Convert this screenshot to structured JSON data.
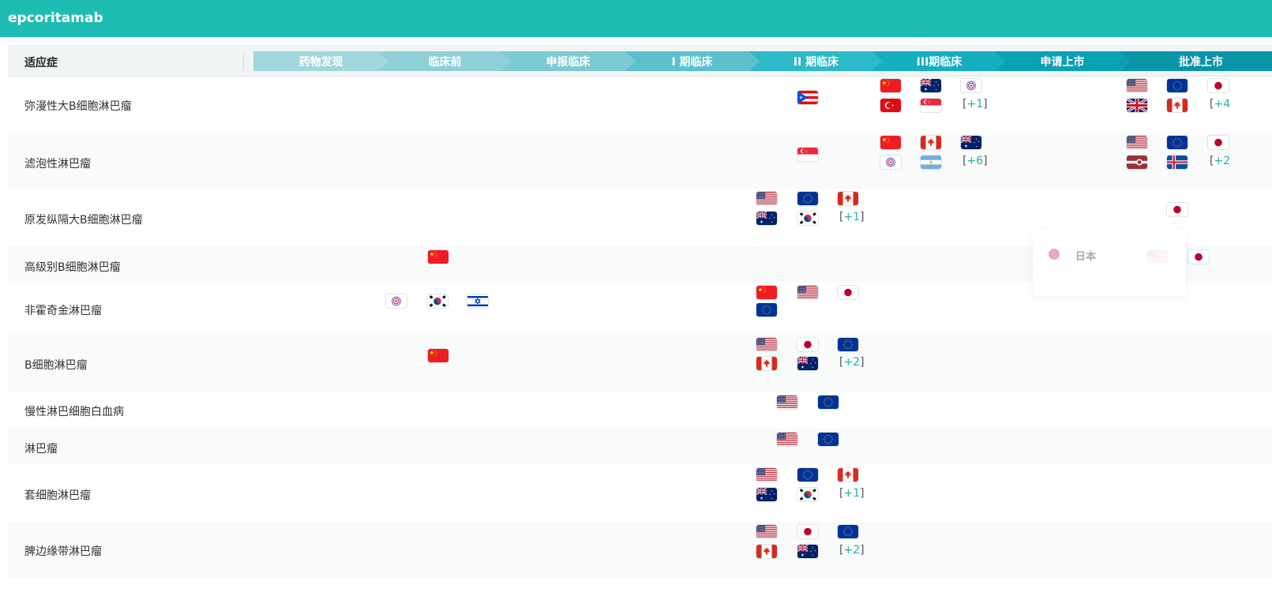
{
  "app": {
    "title": "epcoritamab"
  },
  "header": {
    "indication_label": "适应症",
    "phases": [
      "药物发现",
      "临床前",
      "申报临床",
      "I 期临床",
      "II 期临床",
      "III期临床",
      "申请上市",
      "批准上市"
    ]
  },
  "colors": {
    "brand": "#1fbcb4",
    "phases": [
      "#a1d7dc",
      "#8fd0d6",
      "#7dcad2",
      "#5cc0cd",
      "#2cb9c8",
      "#14aec0",
      "#0aa1b3",
      "#0995a7"
    ],
    "more_count": "#1fb4ac"
  },
  "tooltip": {
    "label": "日本",
    "icon": "japan-flag-icon"
  },
  "rows": [
    {
      "name": "弥漫性大B细胞淋巴瘤",
      "flags": [
        {
          "code": "pr"
        },
        {
          "code": "cn"
        },
        {
          "code": "au"
        },
        {
          "code": "tw"
        },
        {
          "code": "tr"
        },
        {
          "code": "sg"
        },
        {
          "code": "us"
        },
        {
          "code": "eu"
        },
        {
          "code": "jp"
        },
        {
          "code": "gb"
        },
        {
          "code": "ca"
        }
      ],
      "more": [
        {
          "open": "[",
          "num": "+1",
          "close": "]"
        },
        {
          "open": "[",
          "num": "+4",
          "close": ""
        }
      ]
    },
    {
      "name": "滤泡性淋巴瘤",
      "flags": [
        {
          "code": "sg"
        },
        {
          "code": "cn"
        },
        {
          "code": "ca"
        },
        {
          "code": "au"
        },
        {
          "code": "tw"
        },
        {
          "code": "ar"
        },
        {
          "code": "us"
        },
        {
          "code": "eu"
        },
        {
          "code": "jp"
        },
        {
          "code": "lv"
        },
        {
          "code": "is"
        }
      ],
      "more": [
        {
          "open": "[",
          "num": "+6",
          "close": "]"
        },
        {
          "open": "[",
          "num": "+2",
          "close": ""
        }
      ]
    },
    {
      "name": "原发纵隔大B细胞淋巴瘤",
      "flags": [
        {
          "code": "us"
        },
        {
          "code": "eu"
        },
        {
          "code": "ca"
        },
        {
          "code": "au"
        },
        {
          "code": "kr"
        },
        {
          "code": "jp"
        }
      ],
      "more": [
        {
          "open": "[",
          "num": "+1",
          "close": "]"
        }
      ]
    },
    {
      "name": "高级别B细胞淋巴瘤",
      "flags": [
        {
          "code": "cn"
        },
        {
          "code": "us"
        },
        {
          "code": "jp"
        }
      ],
      "more": []
    },
    {
      "name": "非霍奇金淋巴瘤",
      "flags": [
        {
          "code": "tw"
        },
        {
          "code": "kr"
        },
        {
          "code": "il"
        },
        {
          "code": "cn"
        },
        {
          "code": "us"
        },
        {
          "code": "jp"
        },
        {
          "code": "eu"
        }
      ],
      "more": []
    },
    {
      "name": "B细胞淋巴瘤",
      "flags": [
        {
          "code": "cn"
        },
        {
          "code": "us"
        },
        {
          "code": "jp"
        },
        {
          "code": "eu"
        },
        {
          "code": "ca"
        },
        {
          "code": "au"
        }
      ],
      "more": [
        {
          "open": "[",
          "num": "+2",
          "close": "]"
        }
      ]
    },
    {
      "name": "慢性淋巴细胞白血病",
      "flags": [
        {
          "code": "us"
        },
        {
          "code": "eu"
        }
      ],
      "more": []
    },
    {
      "name": "淋巴瘤",
      "flags": [
        {
          "code": "us"
        },
        {
          "code": "eu"
        }
      ],
      "more": []
    },
    {
      "name": "套细胞淋巴瘤",
      "flags": [
        {
          "code": "us"
        },
        {
          "code": "eu"
        },
        {
          "code": "ca"
        },
        {
          "code": "au"
        },
        {
          "code": "kr"
        }
      ],
      "more": [
        {
          "open": "[",
          "num": "+1",
          "close": "]"
        }
      ]
    },
    {
      "name": "脾边缘带淋巴瘤",
      "flags": [
        {
          "code": "us"
        },
        {
          "code": "jp"
        },
        {
          "code": "eu"
        },
        {
          "code": "ca"
        },
        {
          "code": "au"
        }
      ],
      "more": [
        {
          "open": "[",
          "num": "+2",
          "close": "]"
        }
      ]
    }
  ]
}
